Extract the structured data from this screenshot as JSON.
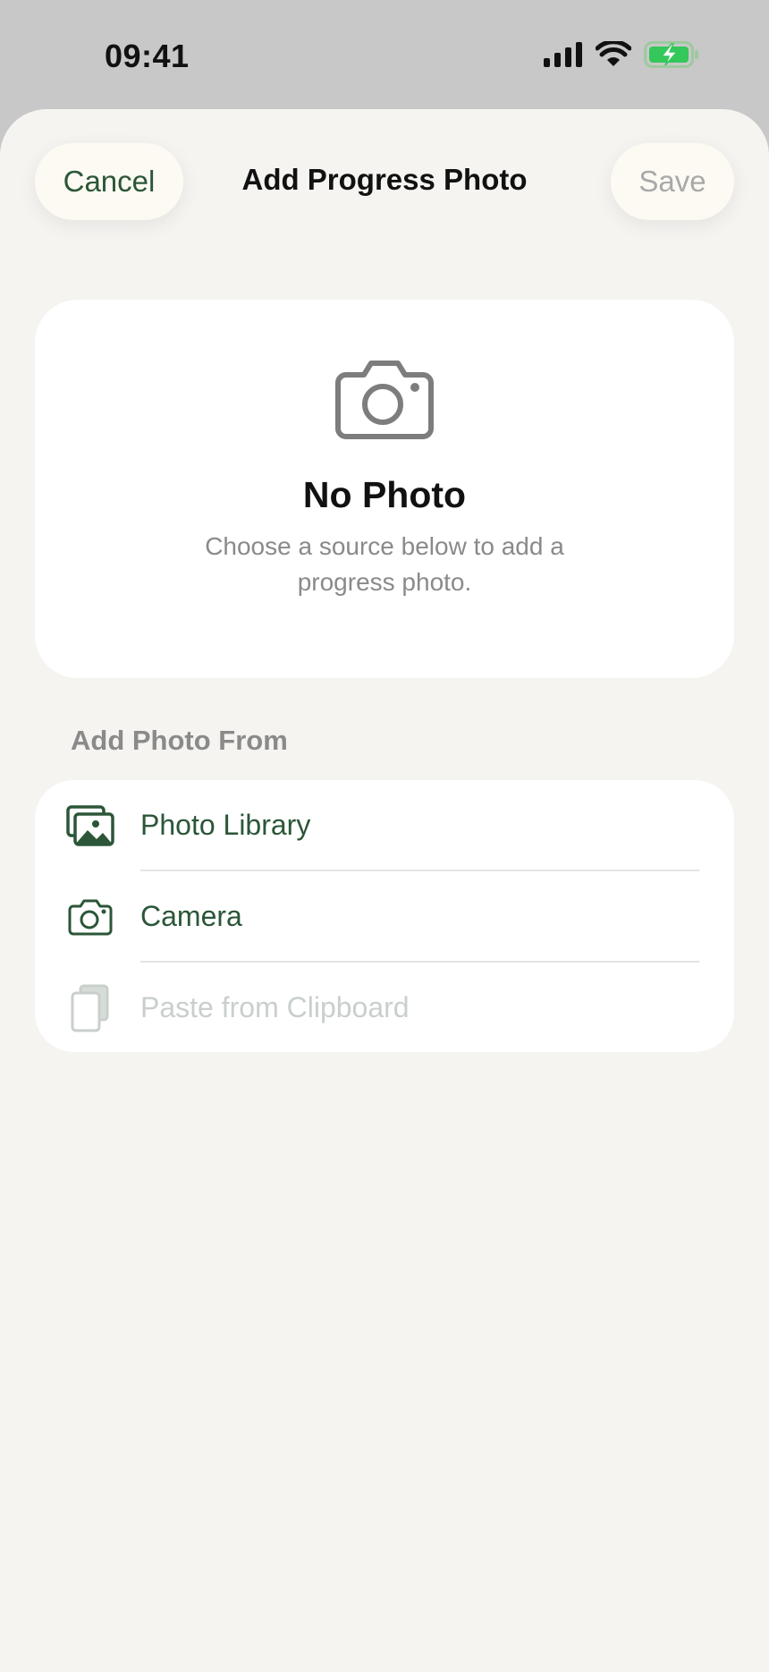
{
  "status_bar": {
    "time": "09:41",
    "icons": [
      "signal-icon",
      "wifi-icon",
      "battery-charging-icon"
    ],
    "battery_color": "#34c759"
  },
  "nav": {
    "cancel_label": "Cancel",
    "title": "Add Progress Photo",
    "save_label": "Save"
  },
  "preview": {
    "icon": "camera-icon",
    "title": "No Photo",
    "subtitle": "Choose a source below to add a progress photo."
  },
  "sources": {
    "header": "Add Photo From",
    "items": [
      {
        "label": "Photo Library",
        "icon": "photo-library-icon",
        "enabled": true
      },
      {
        "label": "Camera",
        "icon": "camera-icon",
        "enabled": true
      },
      {
        "label": "Paste from Clipboard",
        "icon": "clipboard-icon",
        "enabled": false
      }
    ]
  },
  "colors": {
    "accent": "#2b5638",
    "disabled_text": "#c9cfcb",
    "sheet_background": "#f5f4f1",
    "card_background": "#ffffff",
    "secondary_text": "#8a8a8a"
  }
}
